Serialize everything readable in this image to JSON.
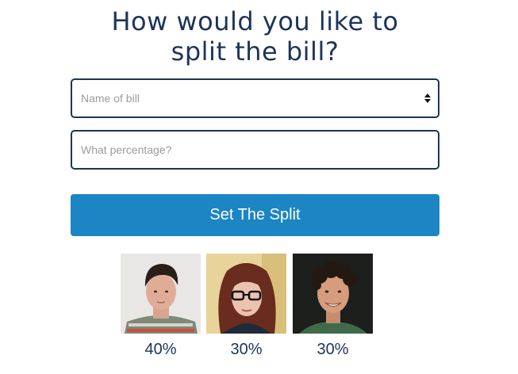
{
  "title": {
    "line1": "How would you like to",
    "line2": "split the bill?"
  },
  "bill_select": {
    "placeholder": "Name of bill",
    "icon": "select-arrows-icon"
  },
  "percentage_input": {
    "placeholder": "What percentage?",
    "value": ""
  },
  "split_button": {
    "label": "Set The Split"
  },
  "people": [
    {
      "icon": "person-avatar",
      "percentage": "40%"
    },
    {
      "icon": "person-avatar",
      "percentage": "30%"
    },
    {
      "icon": "person-avatar",
      "percentage": "30%"
    }
  ],
  "colors": {
    "heading": "#1d3458",
    "border": "#1d3458",
    "button": "#1c85c4",
    "placeholder": "#9b9b9b"
  }
}
